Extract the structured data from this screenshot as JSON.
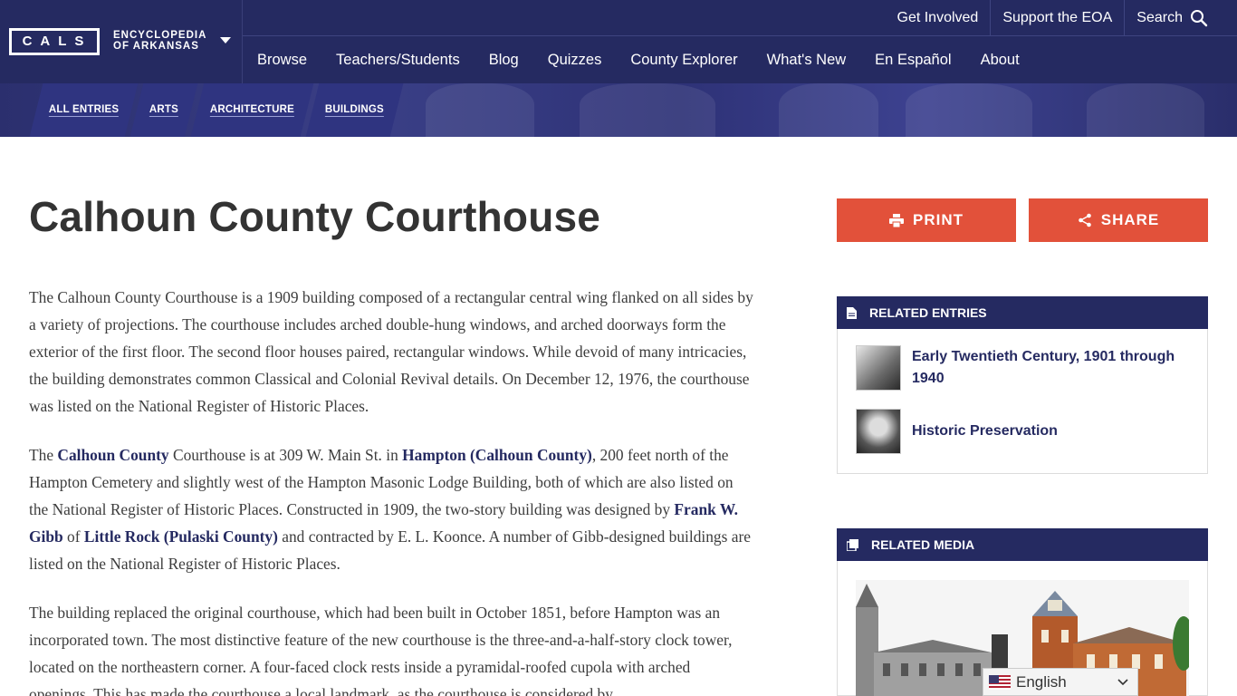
{
  "brand": {
    "logo_text": "CALS",
    "site_name_line1": "ENCYCLOPEDIA",
    "site_name_line2": "OF ARKANSAS"
  },
  "util_nav": [
    "Get Involved",
    "Support the EOA",
    "Search"
  ],
  "main_nav": [
    "Browse",
    "Teachers/Students",
    "Blog",
    "Quizzes",
    "County Explorer",
    "What's New",
    "En Español",
    "About"
  ],
  "breadcrumbs": [
    "ALL ENTRIES",
    "ARTS",
    "ARCHITECTURE",
    "BUILDINGS"
  ],
  "article": {
    "title": "Calhoun County Courthouse",
    "p1": "The Calhoun County Courthouse is a 1909 building composed of a rectangular central wing flanked on all sides by a variety of projections. The courthouse includes arched double-hung windows, and arched doorways form the exterior of the first floor. The second floor houses paired, rectangular windows. While devoid of many intricacies, the building demonstrates common Classical and Colonial Revival details. On December 12, 1976, the courthouse was listed on the National Register of Historic Places.",
    "p2": {
      "t1": "The ",
      "l1": "Calhoun County",
      "t2": " Courthouse is at 309 W. Main St. in ",
      "l2": "Hampton (Calhoun County)",
      "t3": ", 200 feet north of the Hampton Cemetery and slightly west of the Hampton Masonic Lodge Building, both of which are also listed on the National Register of Historic Places. Constructed in 1909, the two-story building was designed by ",
      "l3": "Frank W. Gibb",
      "t4": " of ",
      "l4": "Little Rock (Pulaski County)",
      "t5": " and contracted by E. L. Koonce. A number of Gibb-designed buildings are listed on the National Register of Historic Places."
    },
    "p3": "The building replaced the original courthouse, which had been built in October 1851, before Hampton was an incorporated town. The most distinctive feature of the new courthouse is the three-and-a-half-story clock tower, located on the northeastern corner. A four-faced clock rests inside a pyramidal-roofed cupola with arched openings. This has made the courthouse a local landmark, as the courthouse is considered by"
  },
  "sidebar": {
    "print_label": "PRINT",
    "share_label": "SHARE",
    "related_entries_title": "RELATED ENTRIES",
    "related_entries": [
      "Early Twentieth Century, 1901 through 1940",
      "Historic Preservation"
    ],
    "related_media_title": "RELATED MEDIA"
  },
  "language_selector": "English",
  "colors": {
    "navy": "#252a61",
    "accent": "#e2513a"
  }
}
